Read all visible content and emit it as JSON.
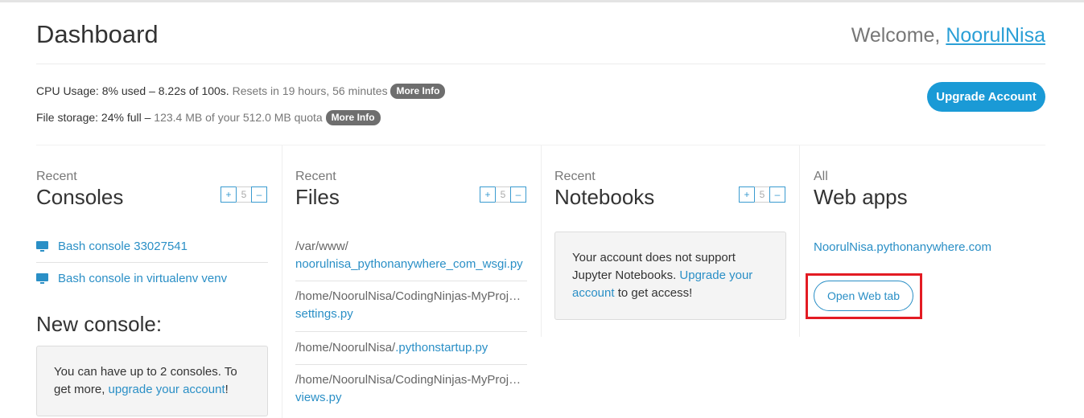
{
  "header": {
    "title": "Dashboard",
    "welcome_prefix": "Welcome, ",
    "username": "NoorulNisa"
  },
  "usage": {
    "cpu_label": "CPU Usage:",
    "cpu_value": " 8% used – 8.22s of 100s.",
    "cpu_reset": " Resets in 19 hours, 56 minutes",
    "storage_label": "File storage:",
    "storage_value": " 24% full –",
    "storage_detail": " 123.4 MB of your 512.0 MB quota",
    "more_info_label": "More Info",
    "upgrade_label": "Upgrade Account"
  },
  "stepper": {
    "plus": "+",
    "count": "5",
    "minus": "–"
  },
  "consoles": {
    "small_label": "Recent",
    "title": "Consoles",
    "items": [
      {
        "label": "Bash console 33027541",
        "icon": "monitor-icon"
      },
      {
        "label": "Bash console in virtualenv venv",
        "icon": "monitor-icon"
      }
    ],
    "new_console_title": "New console:",
    "notice_text": "You can have up to 2 consoles. To get more, ",
    "notice_link": "upgrade your account",
    "notice_suffix": "!"
  },
  "files": {
    "small_label": "Recent",
    "title": "Files",
    "items": [
      {
        "dir": "/var/www/",
        "name": "noorulnisa_pythonanywhere_com_wsgi.py"
      },
      {
        "dir": "/home/NoorulNisa/CodingNinjas-MyProject/",
        "name": "settings.py"
      },
      {
        "dir": "/home/NoorulNisa/",
        "name": ".pythonstartup.py"
      },
      {
        "dir": "/home/NoorulNisa/CodingNinjas-MyProject/",
        "name": "views.py"
      }
    ]
  },
  "notebooks": {
    "small_label": "Recent",
    "title": "Notebooks",
    "notice_text": "Your account does not support Jupyter Notebooks. ",
    "notice_link": "Upgrade your account",
    "notice_suffix": " to get access!"
  },
  "webapps": {
    "small_label": "All",
    "title": "Web apps",
    "app_link": "NoorulNisa.pythonanywhere.com",
    "open_tab_label": "Open Web tab"
  },
  "colors": {
    "accent": "#1a9ad6",
    "link": "#2a8fc6",
    "highlight": "#e31b23",
    "pill": "#6e6e6e"
  }
}
